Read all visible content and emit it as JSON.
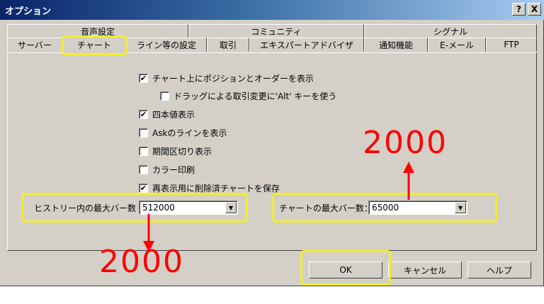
{
  "window": {
    "title": "オプション",
    "help_btn": "?",
    "close_btn": "X"
  },
  "tabs_back": [
    "音声設定",
    "コミュニティ",
    "シグナル"
  ],
  "tabs_front": [
    "サーバー",
    "チャート",
    "ライン等の設定",
    "取引",
    "エキスパートアドバイザ",
    "通知機能",
    "E-メール",
    "FTP"
  ],
  "checkboxes": [
    {
      "label": "チャート上にポジションとオーダーを表示",
      "checked": true
    },
    {
      "label": "ドラッグによる取引変更に'Alt' キーを使う",
      "checked": false
    },
    {
      "label": "四本値表示",
      "checked": true
    },
    {
      "label": "Askのラインを表示",
      "checked": false
    },
    {
      "label": "期間区切り表示",
      "checked": false
    },
    {
      "label": "カラー印刷",
      "checked": false
    },
    {
      "label": "再表示用に削除済チャートを保存",
      "checked": true
    }
  ],
  "history_bars": {
    "label": "ヒストリー内の最大バー数",
    "value": "512000"
  },
  "chart_bars": {
    "label": "チャートの最大バー数：",
    "value": "65000"
  },
  "buttons": {
    "ok": "OK",
    "cancel": "キャンセル",
    "help": "ヘルプ"
  },
  "annotations": {
    "left": "2000",
    "right": "2000"
  },
  "colors": {
    "highlight": "#f2ee2c",
    "annotation": "#ff0000"
  },
  "icons": {
    "checkmark": "✔",
    "dropdown": "▼"
  }
}
